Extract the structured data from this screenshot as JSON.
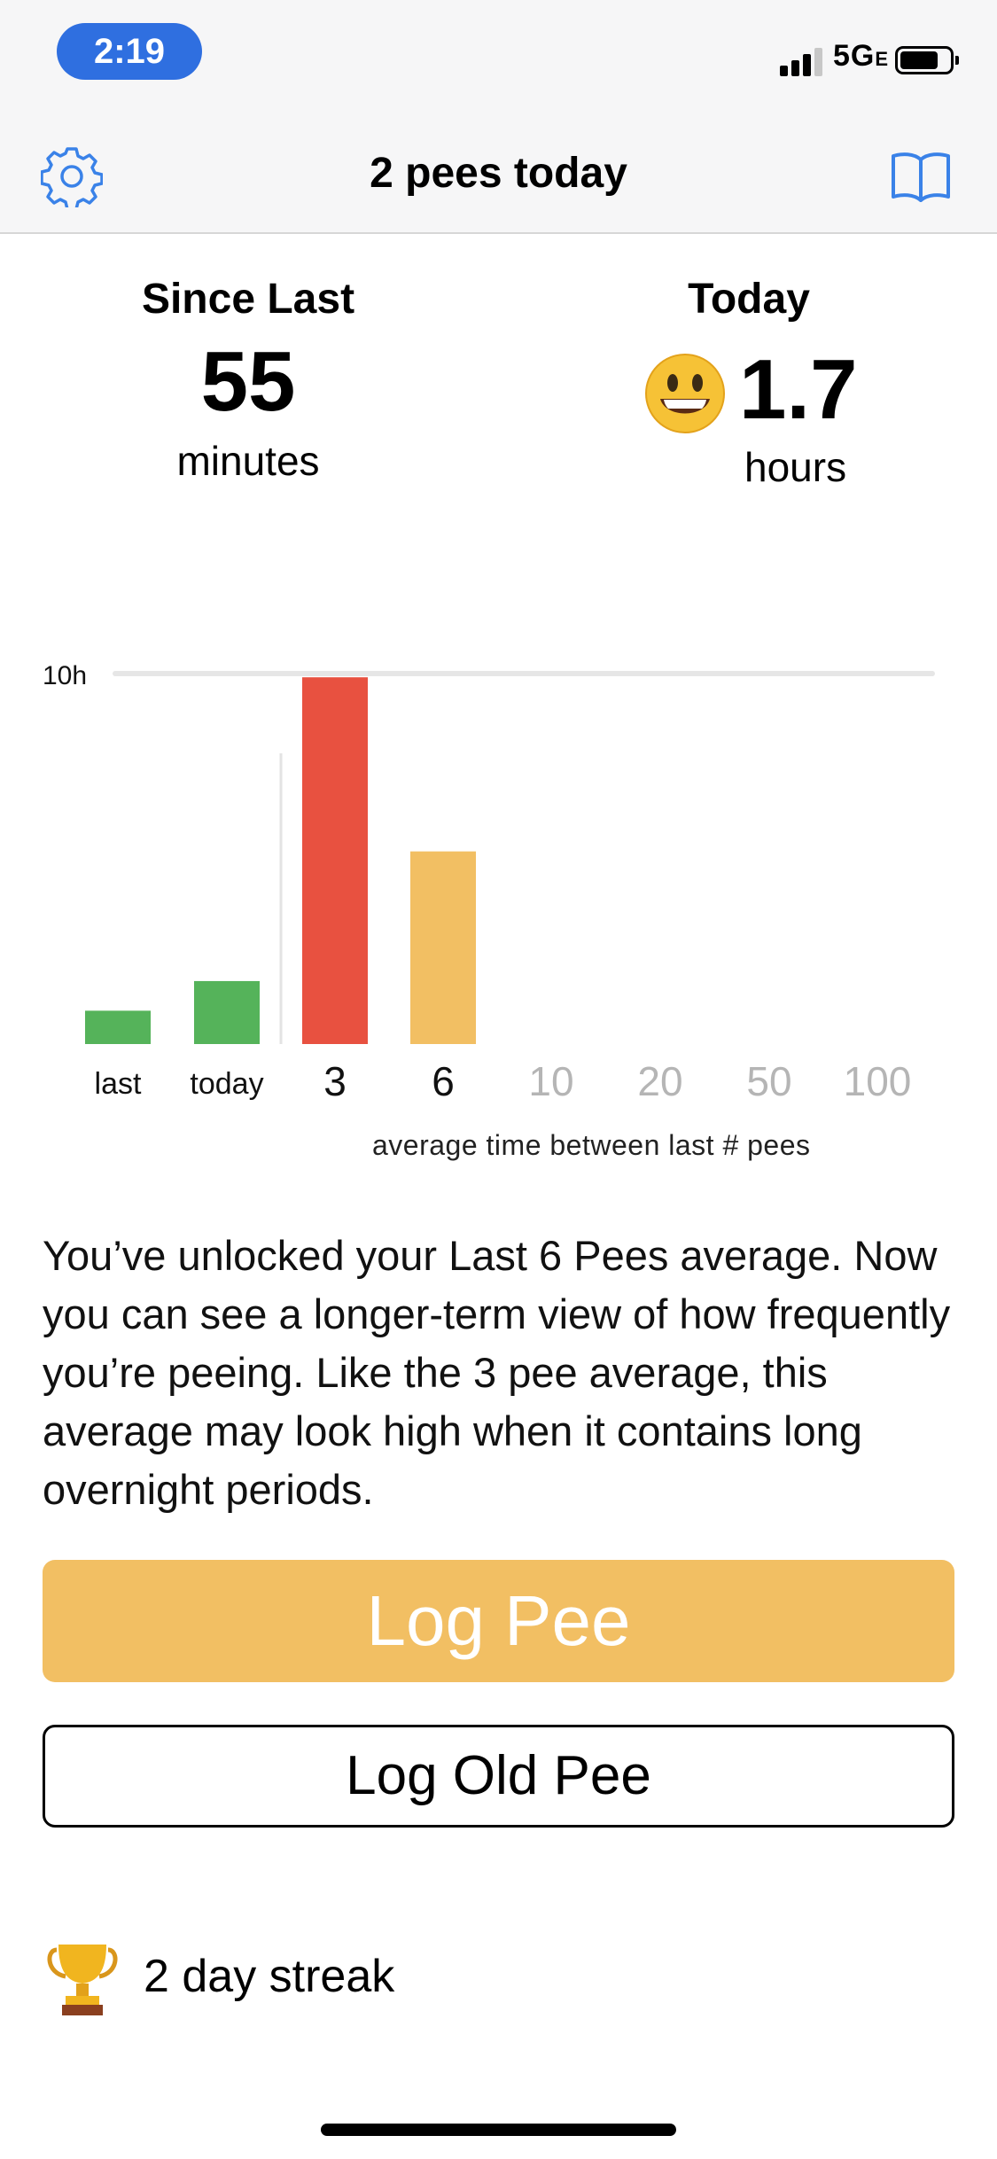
{
  "status_bar": {
    "time": "2:19",
    "network": "5G",
    "network_suffix": "E"
  },
  "nav": {
    "title": "2 pees today",
    "settings_icon": "gear-icon",
    "guide_icon": "book-icon"
  },
  "stats": {
    "since_last": {
      "label": "Since Last",
      "value": "55",
      "unit": "minutes"
    },
    "today": {
      "label": "Today",
      "value": "1.7",
      "unit": "hours",
      "emoji": "smiling-face-icon"
    }
  },
  "chart_data": {
    "type": "bar",
    "ymax_label": "10h",
    "ylim": [
      0,
      10
    ],
    "categories": [
      "last",
      "today",
      "3",
      "6",
      "10",
      "20",
      "50",
      "100"
    ],
    "values": [
      0.9,
      1.7,
      9.9,
      5.2,
      null,
      null,
      null,
      null
    ],
    "colors": [
      "#55b35a",
      "#55b35a",
      "#e85140",
      "#f2bf63",
      null,
      null,
      null,
      null
    ],
    "inactive_categories": [
      "10",
      "20",
      "50",
      "100"
    ],
    "caption": "average time between last # pees"
  },
  "message": "You’ve unlocked your Last 6 Pees average. Now you can see a longer-term view of how frequently you’re peeing. Like the 3 pee average, this average may look high when it contains long overnight periods.",
  "buttons": {
    "log": "Log Pee",
    "log_old": "Log Old Pee"
  },
  "streak": {
    "text": "2 day streak",
    "icon": "trophy-icon"
  },
  "colors": {
    "accent_blue": "#3a82e8",
    "green": "#55b35a",
    "red": "#e85140",
    "yellow": "#f2bf63"
  }
}
